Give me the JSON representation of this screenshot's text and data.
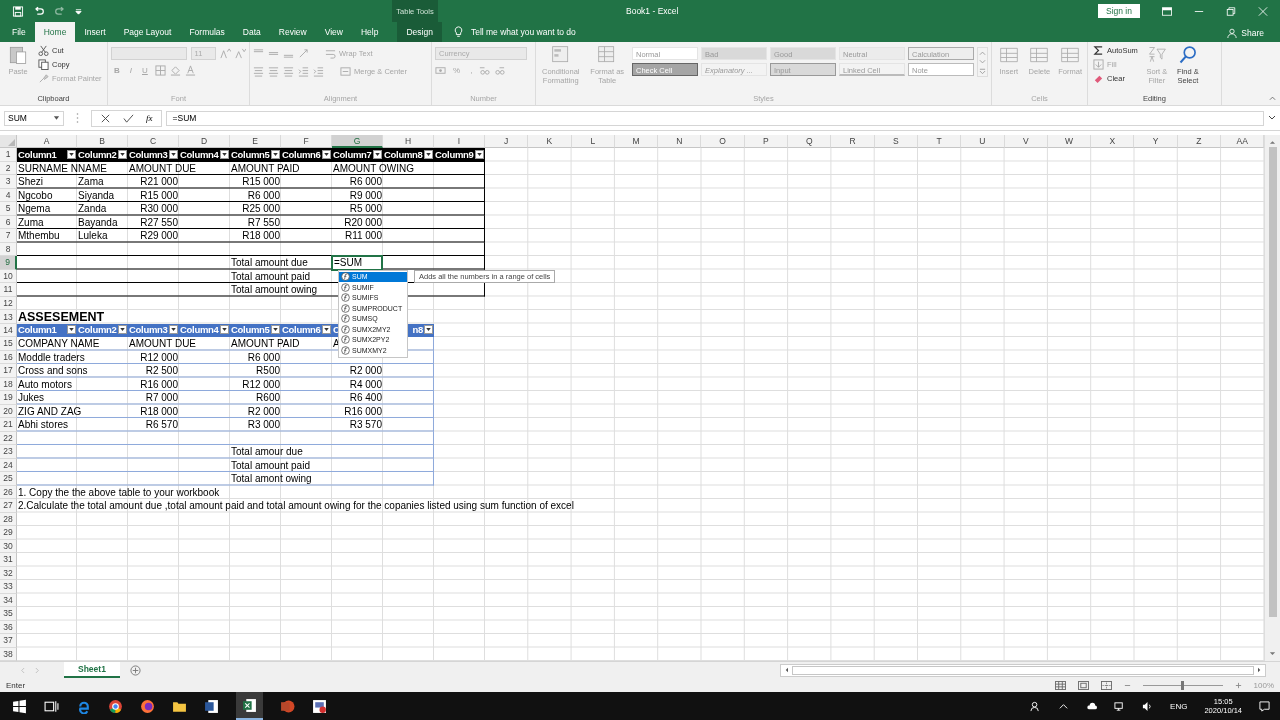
{
  "title_bar": {
    "contextual": "Table Tools",
    "title": "Book1  -  Excel",
    "sign_in": "Sign in"
  },
  "tabs": [
    {
      "label": "File",
      "selected": false,
      "kind": "plain"
    },
    {
      "label": "Home",
      "selected": true,
      "kind": "plain"
    },
    {
      "label": "Insert",
      "selected": false,
      "kind": "plain"
    },
    {
      "label": "Page Layout",
      "selected": false,
      "kind": "plain"
    },
    {
      "label": "Formulas",
      "selected": false,
      "kind": "plain"
    },
    {
      "label": "Data",
      "selected": false,
      "kind": "plain"
    },
    {
      "label": "Review",
      "selected": false,
      "kind": "plain"
    },
    {
      "label": "View",
      "selected": false,
      "kind": "plain"
    },
    {
      "label": "Help",
      "selected": false,
      "kind": "plain"
    },
    {
      "label": "Design",
      "selected": false,
      "kind": "contextual"
    }
  ],
  "tell_me": "Tell me what you want to do",
  "share": "Share",
  "ribbon": {
    "clipboard": {
      "label": "Clipboard",
      "paste": {
        "label": "Paste",
        "disabled": true
      },
      "cut": {
        "label": "Cut",
        "disabled": false
      },
      "copy": {
        "label": "Copy",
        "disabled": false
      },
      "format_painter": {
        "label": "Format Painter",
        "disabled": true
      }
    },
    "font": {
      "label": "Font",
      "disabled": true,
      "size": "11",
      "buttons": [
        "B",
        "I",
        "U"
      ]
    },
    "alignment": {
      "label": "Alignment",
      "disabled": true,
      "wrap": "Wrap Text",
      "merge": "Merge & Center"
    },
    "number": {
      "label": "Number",
      "disabled": true,
      "format": "Currency",
      "percent": "%",
      "comma": ","
    },
    "styles": {
      "label": "Styles",
      "disabled": true,
      "conditional": "Conditional Formatting",
      "format_table": "Format as Table",
      "items": [
        {
          "label": "Normal",
          "color": "#ffffff"
        },
        {
          "label": "Bad",
          "color": "#d9d9d9"
        },
        {
          "label": "Good",
          "color": "#d9d9d9"
        },
        {
          "label": "Neutral",
          "color": "#ececec"
        },
        {
          "label": "Calculation",
          "color": "#eeeeee"
        },
        {
          "label": "Check Cell",
          "color": "#a5a5a5"
        },
        {
          "label": "Explanatory ...",
          "color": "#f3f3f3"
        },
        {
          "label": "Input",
          "color": "#d9d9d9"
        },
        {
          "label": "Linked Cell",
          "color": "#f3f3f3"
        },
        {
          "label": "Note",
          "color": "#ffffff"
        }
      ]
    },
    "cells": {
      "label": "Cells",
      "disabled": true,
      "buttons": [
        "Insert",
        "Delete",
        "Format"
      ]
    },
    "editing": {
      "label": "Editing",
      "autosum": {
        "label": "AutoSum",
        "disabled": false
      },
      "fill": {
        "label": "Fill",
        "disabled": true
      },
      "clear": {
        "label": "Clear",
        "disabled": false
      },
      "sort": {
        "label": "Sort & Filter",
        "disabled": true
      },
      "find": {
        "label": "Find & Select",
        "disabled": false
      }
    }
  },
  "formula_bar": {
    "name_box": "SUM",
    "fx": "fx",
    "formula": "=SUM"
  },
  "sheet": {
    "columns": [
      {
        "label": "A",
        "selected": false
      },
      {
        "label": "B",
        "selected": false
      },
      {
        "label": "C",
        "selected": false
      },
      {
        "label": "D",
        "selected": false
      },
      {
        "label": "E",
        "selected": false
      },
      {
        "label": "F",
        "selected": false
      },
      {
        "label": "G",
        "selected": true
      },
      {
        "label": "H",
        "selected": false
      },
      {
        "label": "I",
        "selected": false
      },
      {
        "label": "J",
        "selected": false
      },
      {
        "label": "K",
        "selected": false
      },
      {
        "label": "L",
        "selected": false
      },
      {
        "label": "M",
        "selected": false
      },
      {
        "label": "N",
        "selected": false
      },
      {
        "label": "O",
        "selected": false
      },
      {
        "label": "P",
        "selected": false
      },
      {
        "label": "Q",
        "selected": false
      },
      {
        "label": "R",
        "selected": false
      },
      {
        "label": "S",
        "selected": false
      },
      {
        "label": "T",
        "selected": false
      },
      {
        "label": "U",
        "selected": false
      },
      {
        "label": "V",
        "selected": false
      },
      {
        "label": "W",
        "selected": false
      },
      {
        "label": "X",
        "selected": false
      },
      {
        "label": "Y",
        "selected": false
      },
      {
        "label": "Z",
        "selected": false
      },
      {
        "label": "AA",
        "selected": false
      }
    ],
    "rows": [
      {
        "number": "1",
        "selected": false,
        "kind": "dark-header",
        "cells": [
          "Column1",
          "Column2",
          "Column3",
          "Column4",
          "Column5",
          "Column6",
          "Column7",
          "Column8",
          "Column9"
        ]
      },
      {
        "number": "2",
        "selected": false,
        "kind": "dark-text",
        "cells": [
          "SURNAME N",
          "NAME",
          "AMOUNT DUE",
          null,
          "AMOUNT PAID",
          null,
          "AMOUNT OWING"
        ]
      },
      {
        "number": "3",
        "selected": false,
        "kind": "dark-row",
        "cells": [
          "Shezi",
          "Zama",
          "R21 000",
          null,
          "R15 000",
          null,
          "R6 000"
        ]
      },
      {
        "number": "4",
        "selected": false,
        "kind": "dark-row",
        "cells": [
          "Ngcobo",
          "Siyanda",
          "R15 000",
          null,
          "R6 000",
          null,
          "R9 000"
        ]
      },
      {
        "number": "5",
        "selected": false,
        "kind": "dark-row",
        "cells": [
          "Ngema",
          "Zanda",
          "R30 000",
          null,
          "R25 000",
          null,
          "R5 000"
        ]
      },
      {
        "number": "6",
        "selected": false,
        "kind": "dark-row",
        "cells": [
          "Zuma",
          "Bayanda",
          "R27 550",
          null,
          "R7 550",
          null,
          "R20 000"
        ]
      },
      {
        "number": "7",
        "selected": false,
        "kind": "dark-row",
        "cells": [
          "Mthembu",
          "Luleka",
          "R29 000",
          null,
          "R18 000",
          null,
          "R11 000"
        ]
      },
      {
        "number": "8",
        "selected": false,
        "kind": "dark-text"
      },
      {
        "number": "9",
        "selected": true,
        "kind": "dark-text",
        "cells": [
          null,
          null,
          null,
          null,
          "Total amount due",
          null,
          {
            "text": "=SUM",
            "kind": "editing",
            "tooltip": "Adds all the numbers in a range of cells",
            "suggestions": [
              {
                "label": "SUM",
                "selected": true
              },
              {
                "label": "SUMIF",
                "selected": false
              },
              {
                "label": "SUMIFS",
                "selected": false
              },
              {
                "label": "SUMPRODUCT",
                "selected": false
              },
              {
                "label": "SUMSQ",
                "selected": false
              },
              {
                "label": "SUMX2MY2",
                "selected": false
              },
              {
                "label": "SUMX2PY2",
                "selected": false
              },
              {
                "label": "SUMXMY2",
                "selected": false
              }
            ]
          }
        ]
      },
      {
        "number": "10",
        "selected": false,
        "kind": "dark-text",
        "cells": [
          null,
          null,
          null,
          null,
          "Total amount paid"
        ]
      },
      {
        "number": "11",
        "selected": false,
        "kind": "dark-text",
        "cells": [
          null,
          null,
          null,
          null,
          "Total amount owing"
        ]
      },
      {
        "number": "12",
        "selected": false,
        "kind": "plain"
      },
      {
        "number": "13",
        "selected": false,
        "kind": "title",
        "cells": [
          "ASSESEMENT"
        ]
      },
      {
        "number": "14",
        "selected": false,
        "kind": "blue-header",
        "cells": [
          "Column1",
          "Column2",
          "Column3",
          "Column4",
          "Column5",
          "Column6",
          {
            "text": "C",
            "kind": "partial"
          },
          {
            "text": "n8",
            "kind": "tail"
          }
        ]
      },
      {
        "number": "15",
        "selected": false,
        "kind": "blue-text",
        "cells": [
          "COMPANY NAME",
          null,
          "AMOUNT DUE",
          null,
          "AMOUNT PAID",
          null,
          "A"
        ]
      },
      {
        "number": "16",
        "selected": false,
        "kind": "blue-row",
        "cells": [
          "Moddle traders",
          null,
          "R12 000",
          null,
          "R6 000"
        ]
      },
      {
        "number": "17",
        "selected": false,
        "kind": "blue-row",
        "cells": [
          "Cross and sons",
          null,
          "R2 500",
          null,
          "R500",
          null,
          "R2 000"
        ]
      },
      {
        "number": "18",
        "selected": false,
        "kind": "blue-row",
        "cells": [
          "Auto motors",
          null,
          "R16 000",
          null,
          "R12 000",
          null,
          "R4 000"
        ]
      },
      {
        "number": "19",
        "selected": false,
        "kind": "blue-row",
        "cells": [
          "Jukes",
          null,
          "R7 000",
          null,
          "R600",
          null,
          "R6 400"
        ]
      },
      {
        "number": "20",
        "selected": false,
        "kind": "blue-row",
        "cells": [
          "ZIG AND ZAG",
          null,
          "R18 000",
          null,
          "R2 000",
          null,
          "R16 000"
        ]
      },
      {
        "number": "21",
        "selected": false,
        "kind": "blue-row",
        "cells": [
          "Abhi stores",
          null,
          "R6 570",
          null,
          "R3 000",
          null,
          "R3 570"
        ]
      },
      {
        "number": "22",
        "selected": false,
        "kind": "blue-text"
      },
      {
        "number": "23",
        "selected": false,
        "kind": "blue-text",
        "cells": [
          null,
          null,
          null,
          null,
          "Total amour due"
        ]
      },
      {
        "number": "24",
        "selected": false,
        "kind": "blue-text",
        "cells": [
          null,
          null,
          null,
          null,
          "Total amount paid"
        ]
      },
      {
        "number": "25",
        "selected": false,
        "kind": "blue-text",
        "cells": [
          null,
          null,
          null,
          null,
          "Total amont owing"
        ]
      },
      {
        "number": "26",
        "selected": false,
        "kind": "plain",
        "cells": [
          "1. Copy the the above table to your workbook"
        ]
      },
      {
        "number": "27",
        "selected": false,
        "kind": "plain",
        "cells": [
          "2.Calculate the total amount due ,total amount paid and total amount owing for the copanies listed  using sum function of excel"
        ]
      },
      {
        "number": "28",
        "selected": false,
        "kind": "plain"
      },
      {
        "number": "29",
        "selected": false,
        "kind": "plain"
      },
      {
        "number": "30",
        "selected": false,
        "kind": "plain"
      },
      {
        "number": "31",
        "selected": false,
        "kind": "plain"
      },
      {
        "number": "32",
        "selected": false,
        "kind": "plain"
      },
      {
        "number": "33",
        "selected": false,
        "kind": "plain"
      },
      {
        "number": "34",
        "selected": false,
        "kind": "plain"
      },
      {
        "number": "35",
        "selected": false,
        "kind": "plain"
      },
      {
        "number": "36",
        "selected": false,
        "kind": "plain"
      },
      {
        "number": "37",
        "selected": false,
        "kind": "plain"
      },
      {
        "number": "38",
        "selected": false,
        "kind": "plain"
      }
    ]
  },
  "sheet_tabs": [
    {
      "label": "Sheet1",
      "selected": true
    }
  ],
  "status": {
    "mode": "Enter",
    "zoom": {
      "level": 0.5,
      "reading": "100%"
    }
  },
  "taskbar": {
    "language": "ENG",
    "time": "15:05",
    "date": "2020/10/14"
  }
}
